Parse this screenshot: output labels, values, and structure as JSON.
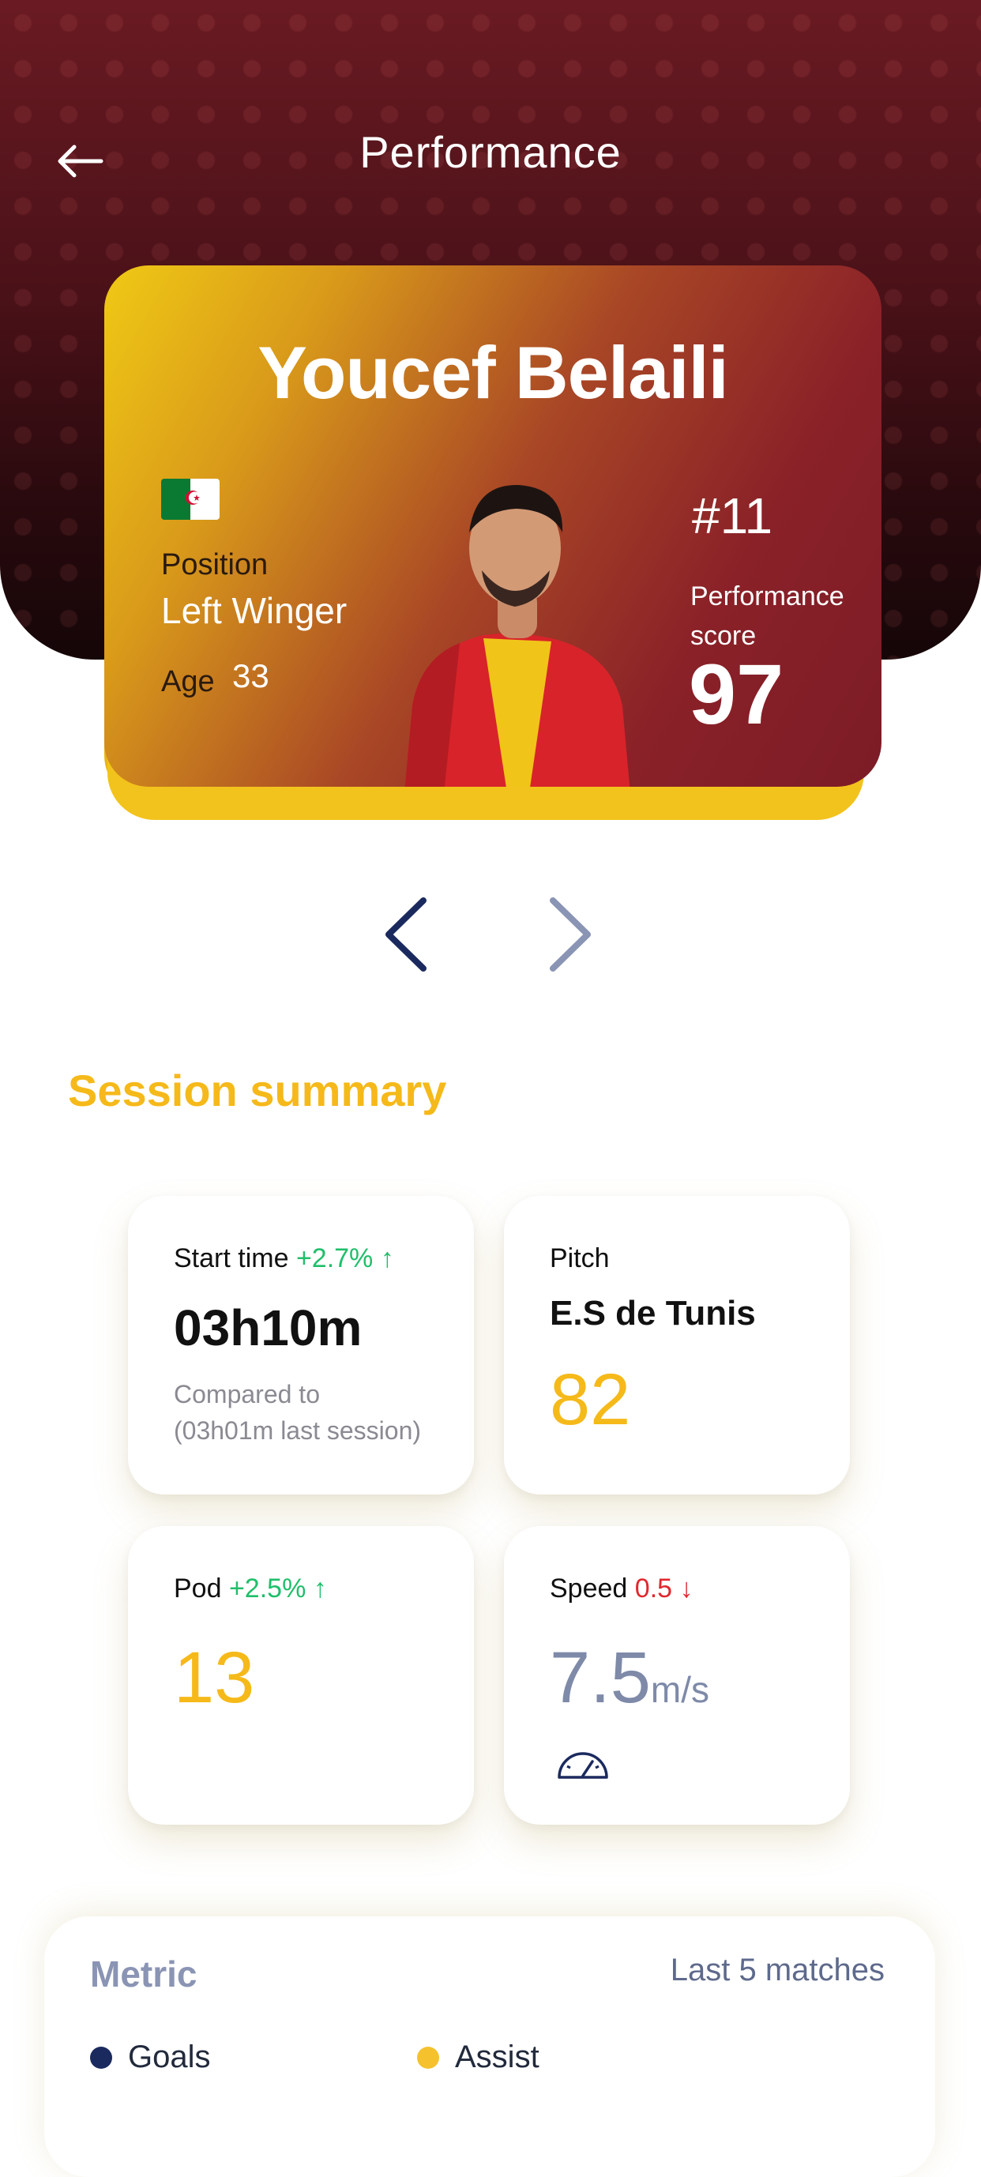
{
  "header": {
    "title": "Performance"
  },
  "player": {
    "name": "Youcef Belaili",
    "position_label": "Position",
    "position_value": "Left Winger",
    "age_label": "Age",
    "age_value": "33",
    "number": "#11",
    "performance_label_line1": "Performance",
    "performance_label_line2": "score",
    "performance_score": "97"
  },
  "session": {
    "title": "Session summary",
    "cards": [
      {
        "label": "Start time",
        "delta": "+2.7%",
        "delta_arrow": "↑",
        "value": "03h10m",
        "sub1": "Compared to",
        "sub2": "(03h01m last session)"
      },
      {
        "label": "Pitch",
        "value": "E.S de Tunis",
        "score": "82"
      },
      {
        "label": "Pod",
        "delta": "+2.5%",
        "delta_arrow": "↑",
        "value": "13"
      },
      {
        "label": "Speed",
        "delta": "0.5",
        "delta_arrow": "↓",
        "value": "7.5",
        "unit": "m/s"
      }
    ]
  },
  "metric": {
    "title": "Metric",
    "range": "Last 5 matches",
    "legend": [
      {
        "label": "Goals",
        "color": "#1b2a5e"
      },
      {
        "label": "Assist",
        "color": "#f5c22e"
      }
    ]
  },
  "colors": {
    "accent": "#f5b91a",
    "positive": "#1fbf6a",
    "negative": "#e0282e"
  },
  "icons": [
    "back-arrow-icon",
    "chevron-left-icon",
    "chevron-right-icon",
    "speedometer-icon",
    "up-arrow-icon",
    "down-arrow-icon"
  ]
}
